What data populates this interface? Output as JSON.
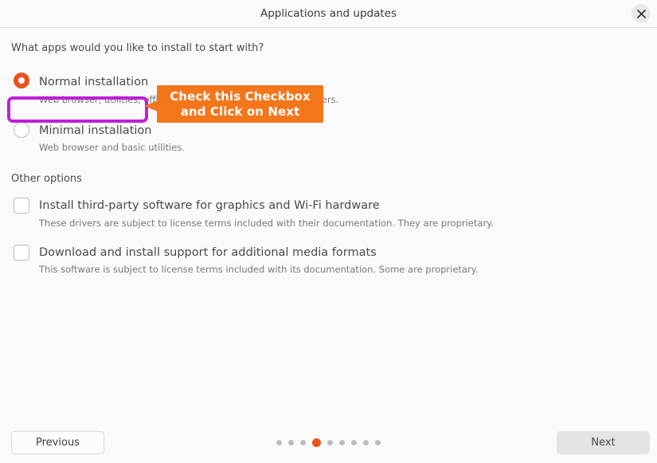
{
  "window": {
    "title": "Applications and updates",
    "close_icon": "close-icon"
  },
  "content": {
    "question": "What apps would you like to install to start with?",
    "install_options": [
      {
        "label": "Normal installation",
        "description": "Web browser, utilities, office software, games and media players.",
        "selected": true
      },
      {
        "label": "Minimal installation",
        "description": "Web browser and basic utilities.",
        "selected": false
      }
    ],
    "other_options_label": "Other options",
    "checkbox_options": [
      {
        "label": "Install third-party software for graphics and Wi-Fi hardware",
        "description": "These drivers are subject to license terms included with their documentation. They are proprietary.",
        "checked": false
      },
      {
        "label": "Download and install support for additional media formats",
        "description": "This software is subject to license terms included with its documentation. Some are proprietary.",
        "checked": false
      }
    ]
  },
  "annotation": {
    "callout_line1": "Check this Checkbox",
    "callout_line2": "and Click on Next",
    "highlight_color": "#bf1fd8",
    "callout_color": "#f4761b"
  },
  "footer": {
    "previous_label": "Previous",
    "next_label": "Next",
    "total_steps": 9,
    "current_step": 4,
    "active_dot_color": "#ea5617",
    "inactive_dot_color": "#bfbdbb"
  }
}
